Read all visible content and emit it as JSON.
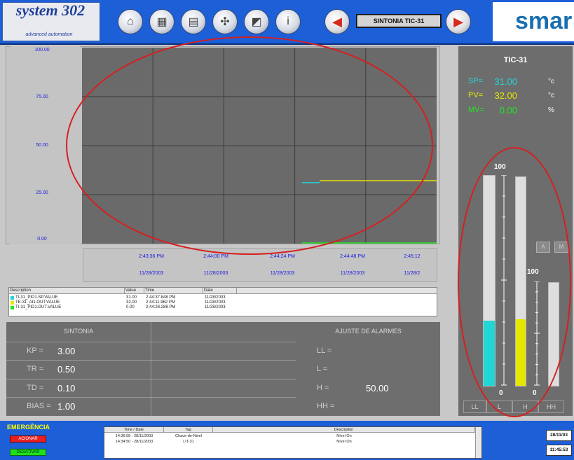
{
  "header": {
    "logo_text": "system 302",
    "logo_subtitle": "advanced automation",
    "screen_label": "SINTONIA TIC-31",
    "brand": "smar",
    "nav_icons": [
      "home-icon",
      "process-icon",
      "panel-icon",
      "valve-icon",
      "trend-icon",
      "info-icon"
    ]
  },
  "chart": {
    "y_ticks": [
      "100.00",
      "75.00",
      "50.00",
      "25.00",
      "0.00"
    ],
    "x_times": [
      "2:43:36 PM",
      "2:44:00 PM",
      "2:44:24 PM",
      "2:44:48 PM",
      "2:45:12"
    ],
    "x_dates": [
      "11/28/2003",
      "11/28/2003",
      "11/28/2003",
      "11/28/2003",
      "11/28/2"
    ],
    "colors": {
      "plot_bg": "#6a6a6a",
      "grid": "#3c3c3c",
      "sp": "#22d6d6",
      "pv": "#e6e600",
      "mv": "#22e622"
    }
  },
  "chart_data": {
    "type": "line",
    "ylim": [
      0,
      100
    ],
    "x": [
      "2:43:36 PM",
      "2:44:00 PM",
      "2:44:24 PM",
      "2:44:48 PM",
      "2:45:12"
    ],
    "series": [
      {
        "name": "TI-31_PID1.SP.VALUE",
        "x_range": [
          0.62,
          0.67
        ],
        "values": [
          31.0,
          31.0
        ]
      },
      {
        "name": "TE-31_AI1.OUT.VALUE",
        "x_range": [
          0.67,
          1.0
        ],
        "values": [
          32.0,
          32.0
        ]
      },
      {
        "name": "TI-31_PID1.OUT.VALUE",
        "x_range": [
          0.62,
          1.0
        ],
        "values": [
          0.0,
          0.0
        ]
      }
    ]
  },
  "legend": {
    "headers": [
      "Description",
      "Value",
      "Time",
      "Date"
    ],
    "rows": [
      {
        "description": "TI-31_PID1.SP.VALUE",
        "value": "31.00",
        "time": "2:44:37.848 PM",
        "date": "11/28/2003",
        "color": "#22d6d6"
      },
      {
        "description": "TE-31_AI1.OUT.VALUE",
        "value": "32.00",
        "time": "2:44:11.962 PM",
        "date": "11/28/2003",
        "color": "#e6e600"
      },
      {
        "description": "TI-31_PID1.OUT.VALUE",
        "value": "0.00",
        "time": "2:44:28.288 PM",
        "date": "11/28/2003",
        "color": "#22e622"
      }
    ]
  },
  "tuning": {
    "title": "SINTONIA",
    "rows": [
      {
        "label": "KP =",
        "value": "3.00"
      },
      {
        "label": "TR =",
        "value": "0.50"
      },
      {
        "label": "TD =",
        "value": "0.10"
      },
      {
        "label": "BIAS =",
        "value": "1.00"
      }
    ]
  },
  "alarms": {
    "title": "AJUSTE DE ALARMES",
    "rows": [
      {
        "label": "LL =",
        "value": ""
      },
      {
        "label": "L =",
        "value": ""
      },
      {
        "label": "H =",
        "value": "50.00"
      },
      {
        "label": "HH =",
        "value": ""
      }
    ]
  },
  "controller": {
    "tag": "TIC-31",
    "sp_label": "SP=",
    "sp_value": "31.00",
    "sp_unit": "°c",
    "pv_label": "PV=",
    "pv_value": "32.00",
    "pv_unit": "°c",
    "mv_label": "MV=",
    "mv_value": "0.00",
    "mv_unit": "%",
    "colors": {
      "sp": "#22d6d6",
      "pv": "#e6e600",
      "mv": "#22e622"
    },
    "scale_top": "100",
    "scale_bottom": "0",
    "scale2_top": "100",
    "scale2_bottom": "0",
    "sp_bar_fraction": 0.31,
    "pv_bar_fraction": 0.32,
    "mv_bar_fraction": 0.0,
    "toggle_a": "A",
    "toggle_m": "M",
    "limit_labels": [
      "LL",
      "L",
      "H",
      "HH"
    ]
  },
  "alarm_strip": {
    "title": "EMERGÊNCIA",
    "activate": "ACIONAR",
    "deactivate": "DESATIVAR",
    "headers": [
      "Time / Date",
      "Tag",
      "Description"
    ],
    "rows": [
      {
        "time": "14:36:58 - 28/11/2003",
        "tag": "Chave-de-Nivel",
        "desc": "Nível On"
      },
      {
        "time": "14:34:50 - 28/11/2003",
        "tag": "LIT-31",
        "desc": "Nível On"
      }
    ],
    "date": "28/11/03",
    "time": "11:45:53"
  }
}
